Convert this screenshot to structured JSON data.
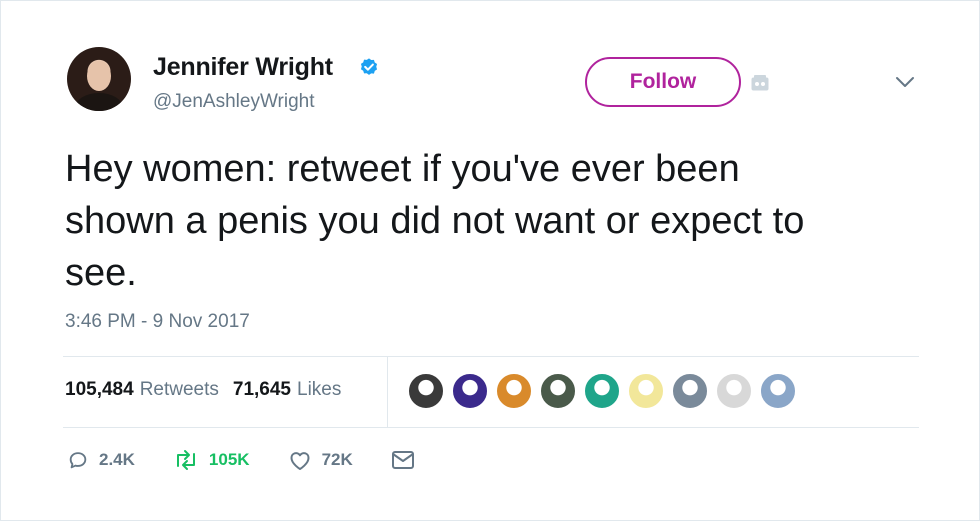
{
  "author": {
    "display_name": "Jennifer Wright",
    "handle": "@JenAshleyWright",
    "verified": true
  },
  "follow_button": {
    "label": "Follow"
  },
  "tweet": {
    "text": "Hey women: retweet if you've ever been\nshown a penis you did not want or expect to\nsee.",
    "timestamp": "3:46 PM - 9 Nov 2017"
  },
  "stats": {
    "retweets_count": "105,484",
    "retweets_label": "Retweets",
    "likes_count": "71,645",
    "likes_label": "Likes"
  },
  "likers": [
    {
      "color": "#3a3a3a"
    },
    {
      "color": "#3b2a8c"
    },
    {
      "color": "#d98a2b"
    },
    {
      "color": "#4a5a4a"
    },
    {
      "color": "#1fa58a"
    },
    {
      "color": "#f2e79a"
    },
    {
      "color": "#7a8a9a"
    },
    {
      "color": "#d8d8d8"
    },
    {
      "color": "#8aa6c8"
    }
  ],
  "actions": {
    "reply_count": "2.4K",
    "retweet_count": "105K",
    "like_count": "72K"
  },
  "colors": {
    "follow_accent": "#b0239d",
    "verified_blue": "#1da1f2",
    "retweet_green": "#17bf63",
    "muted_text": "#657786"
  }
}
